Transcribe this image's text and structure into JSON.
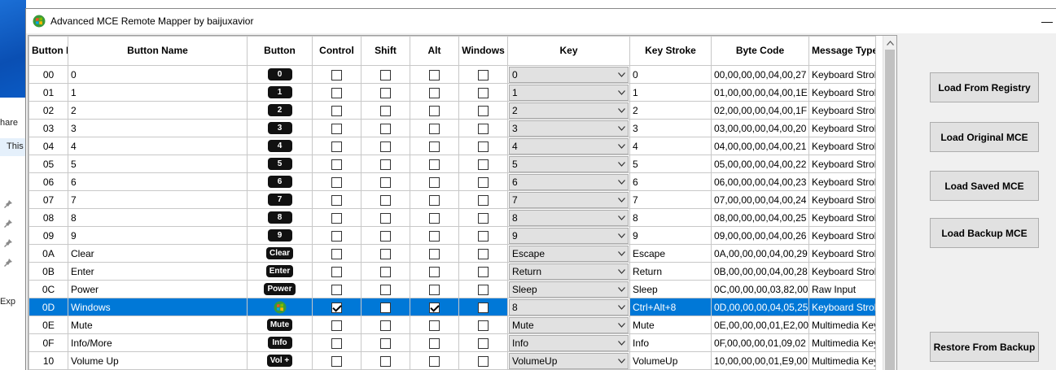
{
  "window": {
    "title": "Advanced MCE Remote Mapper by baijuxavior",
    "close_glyph": "―"
  },
  "background": {
    "frag_share": "hare",
    "frag_this": "This",
    "frag_exp": "Exp"
  },
  "columns": {
    "id": "Button ID",
    "name": "Button Name",
    "button": "Button",
    "control": "Control",
    "shift": "Shift",
    "alt": "Alt",
    "windows": "Windows",
    "key": "Key",
    "keystroke": "Key Stroke",
    "bytecode": "Byte Code",
    "msgtype": "Message Type"
  },
  "rows": [
    {
      "id": "00",
      "name": "0",
      "badge": "0",
      "control": false,
      "shift": false,
      "alt": false,
      "windows": false,
      "key": "0",
      "keystroke": "0",
      "bytecode": "00,00,00,00,04,00,27",
      "msgtype": "Keyboard Stroke"
    },
    {
      "id": "01",
      "name": "1",
      "badge": "1",
      "control": false,
      "shift": false,
      "alt": false,
      "windows": false,
      "key": "1",
      "keystroke": "1",
      "bytecode": "01,00,00,00,04,00,1E",
      "msgtype": "Keyboard Stroke"
    },
    {
      "id": "02",
      "name": "2",
      "badge": "2",
      "control": false,
      "shift": false,
      "alt": false,
      "windows": false,
      "key": "2",
      "keystroke": "2",
      "bytecode": "02,00,00,00,04,00,1F",
      "msgtype": "Keyboard Stroke"
    },
    {
      "id": "03",
      "name": "3",
      "badge": "3",
      "control": false,
      "shift": false,
      "alt": false,
      "windows": false,
      "key": "3",
      "keystroke": "3",
      "bytecode": "03,00,00,00,04,00,20",
      "msgtype": "Keyboard Stroke"
    },
    {
      "id": "04",
      "name": "4",
      "badge": "4",
      "control": false,
      "shift": false,
      "alt": false,
      "windows": false,
      "key": "4",
      "keystroke": "4",
      "bytecode": "04,00,00,00,04,00,21",
      "msgtype": "Keyboard Stroke"
    },
    {
      "id": "05",
      "name": "5",
      "badge": "5",
      "control": false,
      "shift": false,
      "alt": false,
      "windows": false,
      "key": "5",
      "keystroke": "5",
      "bytecode": "05,00,00,00,04,00,22",
      "msgtype": "Keyboard Stroke"
    },
    {
      "id": "06",
      "name": "6",
      "badge": "6",
      "control": false,
      "shift": false,
      "alt": false,
      "windows": false,
      "key": "6",
      "keystroke": "6",
      "bytecode": "06,00,00,00,04,00,23",
      "msgtype": "Keyboard Stroke"
    },
    {
      "id": "07",
      "name": "7",
      "badge": "7",
      "control": false,
      "shift": false,
      "alt": false,
      "windows": false,
      "key": "7",
      "keystroke": "7",
      "bytecode": "07,00,00,00,04,00,24",
      "msgtype": "Keyboard Stroke"
    },
    {
      "id": "08",
      "name": "8",
      "badge": "8",
      "control": false,
      "shift": false,
      "alt": false,
      "windows": false,
      "key": "8",
      "keystroke": "8",
      "bytecode": "08,00,00,00,04,00,25",
      "msgtype": "Keyboard Stroke"
    },
    {
      "id": "09",
      "name": "9",
      "badge": "9",
      "control": false,
      "shift": false,
      "alt": false,
      "windows": false,
      "key": "9",
      "keystroke": "9",
      "bytecode": "09,00,00,00,04,00,26",
      "msgtype": "Keyboard Stroke"
    },
    {
      "id": "0A",
      "name": "Clear",
      "badge": "Clear",
      "control": false,
      "shift": false,
      "alt": false,
      "windows": false,
      "key": "Escape",
      "keystroke": "Escape",
      "bytecode": "0A,00,00,00,04,00,29",
      "msgtype": "Keyboard Stroke"
    },
    {
      "id": "0B",
      "name": "Enter",
      "badge": "Enter",
      "control": false,
      "shift": false,
      "alt": false,
      "windows": false,
      "key": "Return",
      "keystroke": "Return",
      "bytecode": "0B,00,00,00,04,00,28",
      "msgtype": "Keyboard Stroke"
    },
    {
      "id": "0C",
      "name": "Power",
      "badge": "Power",
      "control": false,
      "shift": false,
      "alt": false,
      "windows": false,
      "key": "Sleep",
      "keystroke": "Sleep",
      "bytecode": "0C,00,00,00,03,82,00",
      "msgtype": "Raw Input"
    },
    {
      "id": "0D",
      "name": "Windows",
      "badge": "",
      "badge_icon": "windows-logo-icon",
      "control": true,
      "shift": false,
      "alt": true,
      "windows": false,
      "key": "8",
      "keystroke": "Ctrl+Alt+8",
      "bytecode": "0D,00,00,00,04,05,25",
      "msgtype": "Keyboard Stroke",
      "selected": true
    },
    {
      "id": "0E",
      "name": "Mute",
      "badge": "Mute",
      "control": false,
      "shift": false,
      "alt": false,
      "windows": false,
      "key": "Mute",
      "keystroke": "Mute",
      "bytecode": "0E,00,00,00,01,E2,00",
      "msgtype": "Multimedia Key"
    },
    {
      "id": "0F",
      "name": "Info/More",
      "badge": "Info",
      "control": false,
      "shift": false,
      "alt": false,
      "windows": false,
      "key": "Info",
      "keystroke": "Info",
      "bytecode": "0F,00,00,00,01,09,02",
      "msgtype": "Multimedia Key"
    },
    {
      "id": "10",
      "name": "Volume Up",
      "badge": "Vol +",
      "control": false,
      "shift": false,
      "alt": false,
      "windows": false,
      "key": "VolumeUp",
      "keystroke": "VolumeUp",
      "bytecode": "10,00,00,00,01,E9,00",
      "msgtype": "Multimedia Key"
    }
  ],
  "side_buttons": {
    "load_registry": "Load From Registry",
    "load_original": "Load Original MCE",
    "load_saved": "Load Saved MCE",
    "load_backup": "Load Backup MCE",
    "restore_backup": "Restore From Backup"
  }
}
